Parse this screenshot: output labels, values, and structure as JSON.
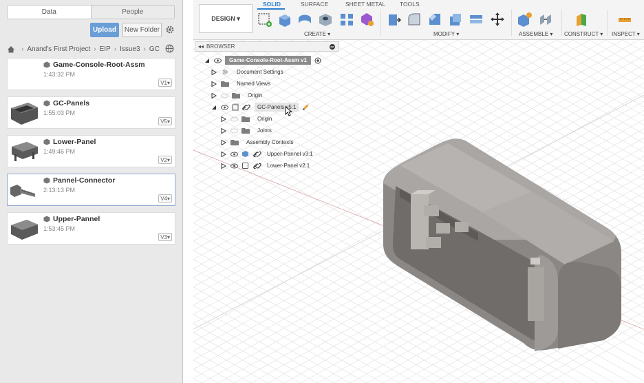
{
  "left_panel": {
    "tabs": {
      "data": "Data",
      "people": "People"
    },
    "upload_label": "Upload",
    "new_folder_label": "New Folder",
    "breadcrumb": [
      "Anand's First Project",
      "EIP",
      "Issue3",
      "GC"
    ],
    "items": [
      {
        "name": "Game-Console-Root-Assm",
        "time": "1:43:32 PM",
        "version": "V1▾"
      },
      {
        "name": "GC-Panels",
        "time": "1:55:03 PM",
        "version": "V5▾"
      },
      {
        "name": "Lower-Panel",
        "time": "1:49:46 PM",
        "version": "V2▾"
      },
      {
        "name": "Pannel-Connector",
        "time": "2:13:13 PM",
        "version": "V4▾"
      },
      {
        "name": "Upper-Pannel",
        "time": "1:53:45 PM",
        "version": "V3▾"
      }
    ]
  },
  "toolbar": {
    "workspace": "DESIGN ▾",
    "tabs": [
      "SOLID",
      "SURFACE",
      "SHEET METAL",
      "TOOLS"
    ],
    "groups": [
      "CREATE ▾",
      "MODIFY ▾",
      "ASSEMBLE ▾",
      "CONSTRUCT ▾",
      "INSPECT ▾"
    ]
  },
  "browser": {
    "title": "BROWSER",
    "root": "Game-Console-Root-Assm v1",
    "rows": [
      "Document Settings",
      "Named Views",
      "Origin",
      "GC-Panels v5:1",
      "Origin",
      "Joints",
      "Assembly Contexts",
      "Upper-Pannel v3:1",
      "Lower-Panel v2:1"
    ]
  },
  "colors": {
    "accent": "#2b7fd1",
    "upload": "#6a9ed6",
    "root_bar": "#8c8c8c"
  }
}
